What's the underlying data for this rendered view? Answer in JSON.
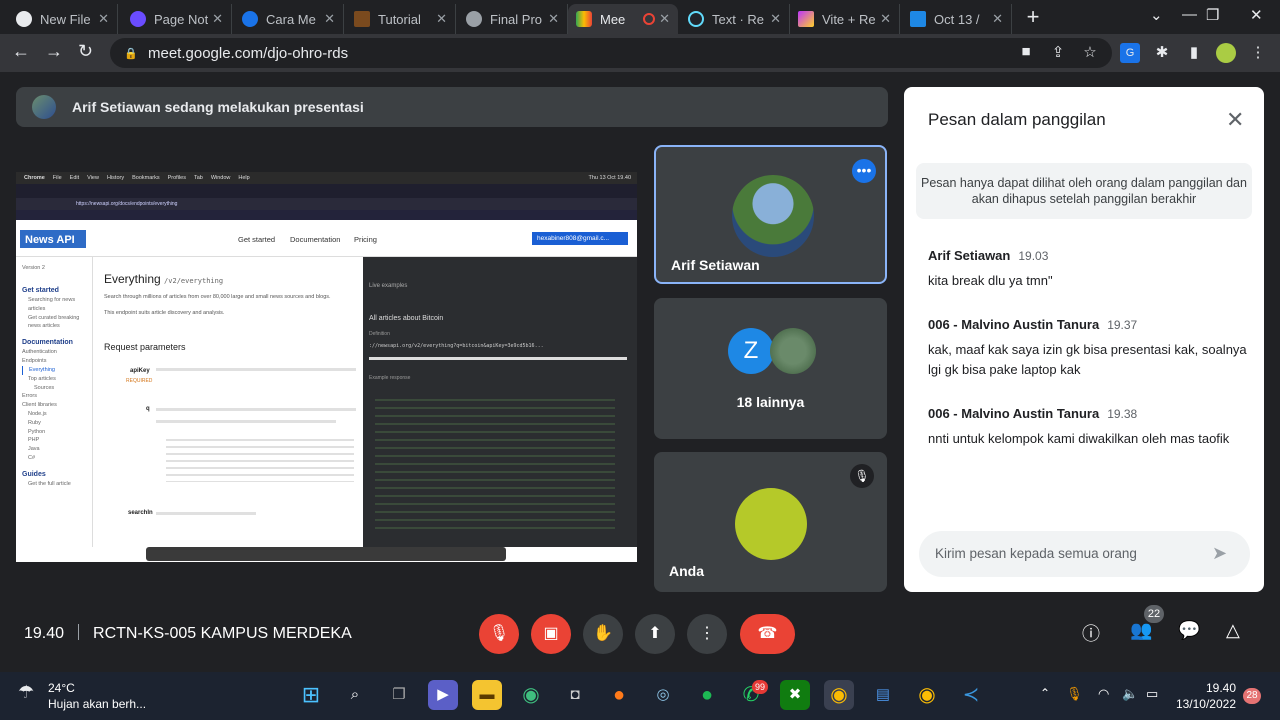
{
  "browser": {
    "tabs": [
      {
        "label": "New File",
        "color": "#e8eaed"
      },
      {
        "label": "Page Not",
        "color": "#8ab4f8"
      },
      {
        "label": "Cara Me",
        "color": "#1a73e8"
      },
      {
        "label": "Tutorial",
        "color": "#5c3b1e"
      },
      {
        "label": "Final Pro",
        "color": "#9aa0a6"
      },
      {
        "label": "Mee",
        "color": "#34a853",
        "active": true
      },
      {
        "label": "Text · Re",
        "color": "#61dafb"
      },
      {
        "label": "Vite + Re",
        "color": "#bd34fe"
      },
      {
        "label": "Oct 13 /",
        "color": "#1e88e5"
      }
    ],
    "url": "meet.google.com/djo-ohro-rds"
  },
  "meet": {
    "presenting_banner": "Arif Setiawan sedang melakukan presentasi",
    "participants": {
      "tile1_name": "Arif Setiawan",
      "tile2_letter": "Z",
      "tile2_label": "18 lainnya",
      "tile3_name": "Anda"
    },
    "shared_screen": {
      "menubar": [
        "Chrome",
        "File",
        "Edit",
        "View",
        "History",
        "Bookmarks",
        "Profiles",
        "Tab",
        "Window",
        "Help"
      ],
      "clock": "Thu 13 Oct 19.40",
      "url": "https://newsapi.org/docs/endpoints/everything",
      "logo": "News API",
      "topnav": [
        "Get started",
        "Documentation",
        "Pricing"
      ],
      "account": "hexabiner808@gmail.c...",
      "version": "Version 2",
      "sidebar": [
        "Get started",
        "Searching for news articles",
        "Get curated breaking news articles",
        "Documentation",
        "Authentication",
        "Endpoints",
        "Everything",
        "Top articles",
        "Sources",
        "Errors",
        "Client libraries",
        "Node.js",
        "Ruby",
        "Python",
        "PHP",
        "Java",
        "C#",
        "Guides",
        "Get the full article"
      ],
      "heading": "Everything",
      "heading_path": "/v2/everything",
      "desc1": "Search through millions of articles from over 80,000 large and small news sources and blogs.",
      "desc2": "This endpoint suits article discovery and analysis.",
      "req_params": "Request parameters",
      "param1": "apiKey",
      "param1_req": "REQUIRED",
      "param2": "q",
      "param3": "searchIn",
      "live": "Live examples",
      "all_articles": "All articles about Bitcoin",
      "definition": "Definition",
      "example_url": "://newsapi.org/v2/everything?q=bitcoin&apiKey=3e9cd5b16...",
      "example_response": "Example response"
    },
    "chat": {
      "title": "Pesan dalam panggilan",
      "notice": "Pesan hanya dapat dilihat oleh orang dalam panggilan dan akan dihapus setelah panggilan berakhir",
      "messages": [
        {
          "sender": "Arif Setiawan",
          "time": "19.03",
          "text": "kita break dlu ya tmn\""
        },
        {
          "sender": "006 - Malvino Austin Tanura",
          "time": "19.37",
          "text": "kak, maaf kak saya izin gk bisa presentasi kak, soalnya lgi gk bisa pake laptop kak"
        },
        {
          "sender": "006 - Malvino Austin Tanura",
          "time": "19.38",
          "text": "nnti untuk kelompok kami diwakilkan oleh mas taofik"
        }
      ],
      "input_placeholder": "Kirim pesan kepada semua orang"
    },
    "bottom": {
      "time": "19.40",
      "meeting_name": "RCTN-KS-005 KAMPUS MERDEKA",
      "people_count": "22"
    }
  },
  "taskbar": {
    "weather_temp": "24°C",
    "weather_desc": "Hujan akan berh...",
    "whatsapp_badge": "99",
    "time": "19.40",
    "date": "13/10/2022",
    "notif_count": "28"
  }
}
